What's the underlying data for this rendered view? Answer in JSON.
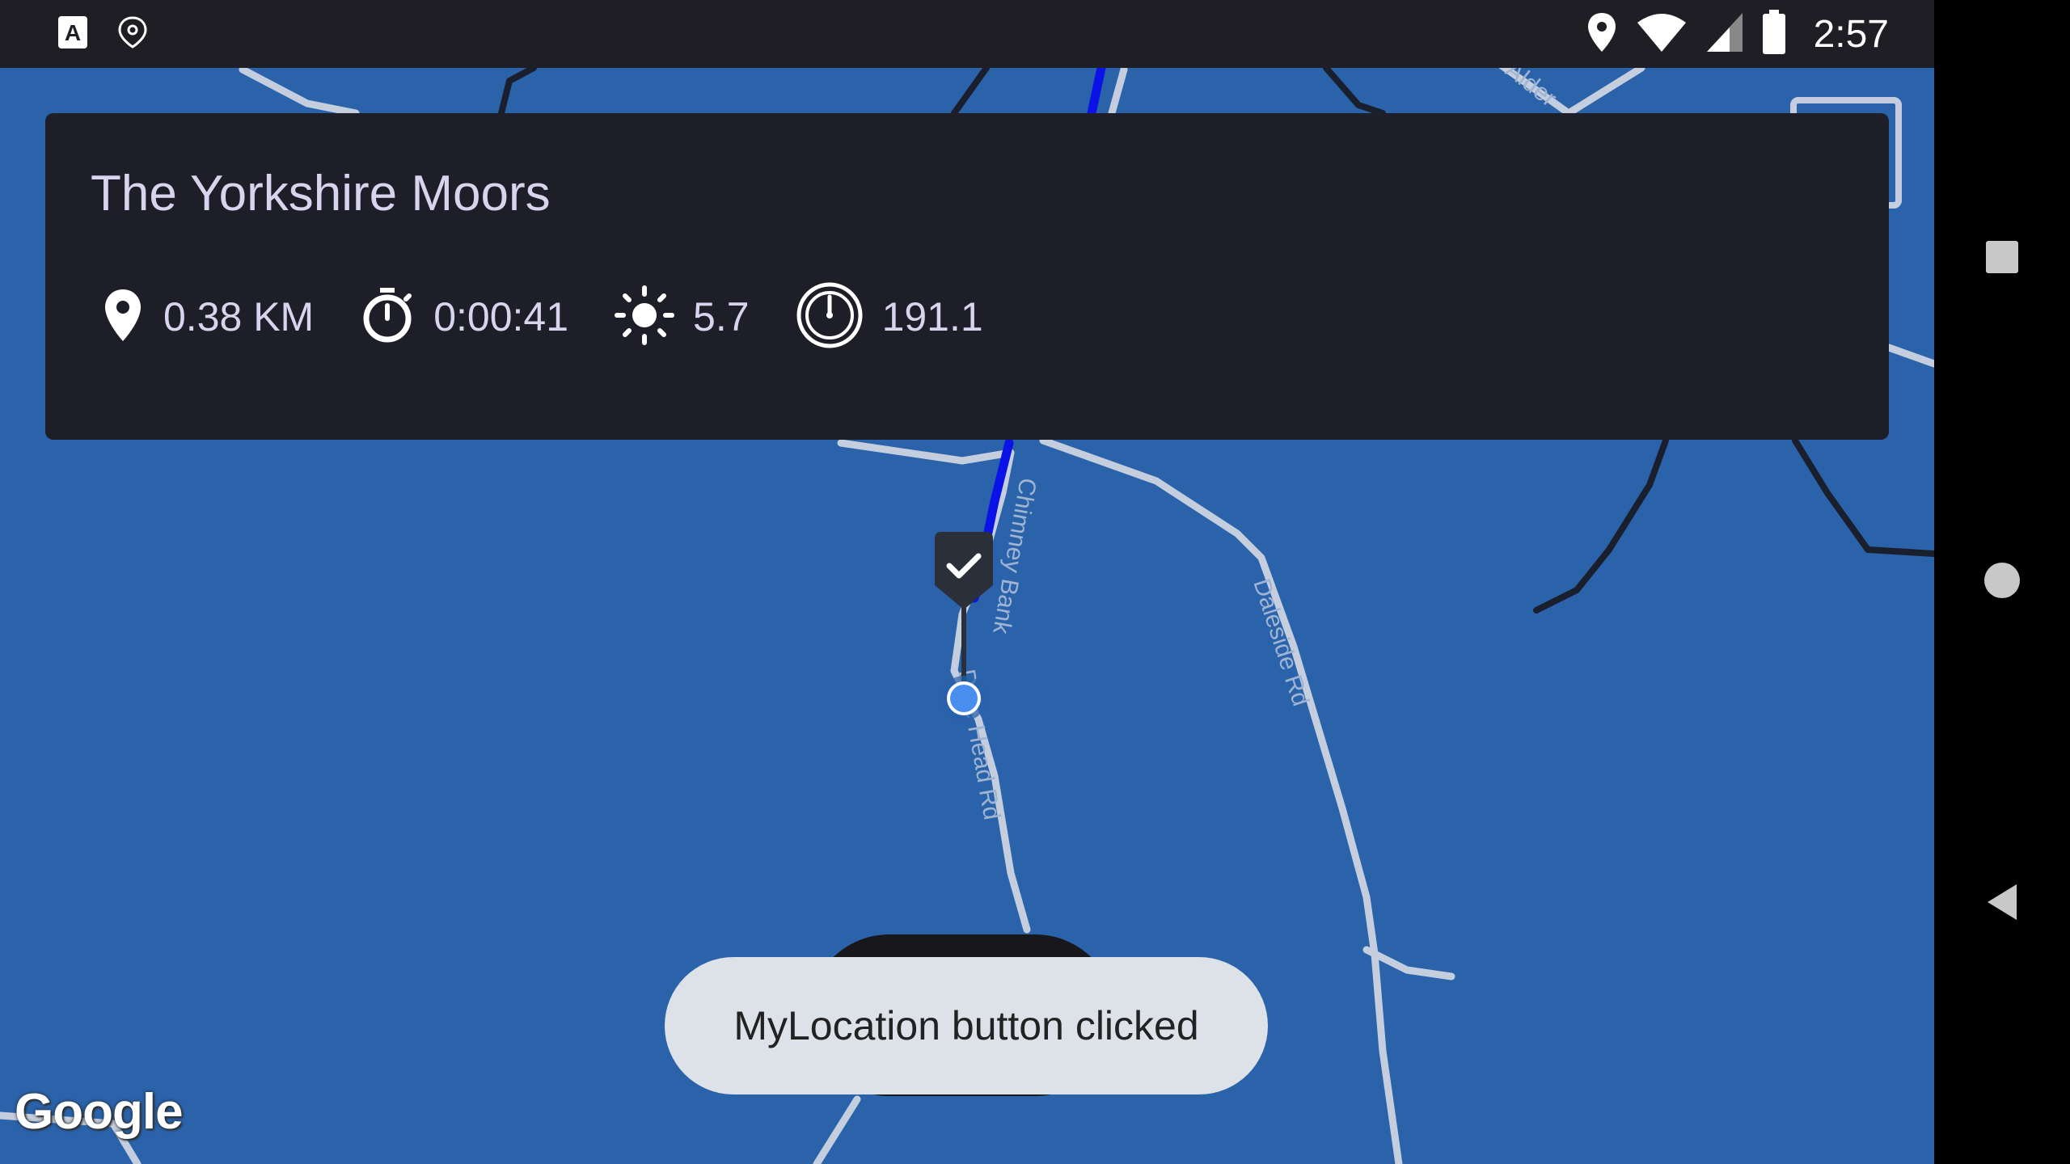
{
  "status_bar": {
    "time": "2:57",
    "left_icons": [
      "app-a-icon",
      "location-shield-icon"
    ],
    "right_icons": [
      "location-pin-icon",
      "wifi-icon",
      "signal-icon",
      "battery-icon"
    ]
  },
  "info_card": {
    "title": "The Yorkshire Moors",
    "stats": [
      {
        "icon": "location-pin-icon",
        "value": "0.38 KM"
      },
      {
        "icon": "stopwatch-icon",
        "value": "0:00:41"
      },
      {
        "icon": "brightness-icon",
        "value": "5.7"
      },
      {
        "icon": "compass-gauge-icon",
        "value": "191.1"
      }
    ]
  },
  "map": {
    "road_labels": [
      "Chimney Bank",
      "Dale Head Rd",
      "Daleside Rd",
      "Alder"
    ],
    "colors": {
      "water": "#2a63aa",
      "road": "#c5cede",
      "route": "#0a12e8",
      "path": "#1a1f2e"
    },
    "branding": "Google"
  },
  "toast": {
    "message": "MyLocation button clicked"
  },
  "nav_bar": {
    "buttons": [
      "recents-square-icon",
      "home-circle-icon",
      "back-triangle-icon"
    ]
  }
}
